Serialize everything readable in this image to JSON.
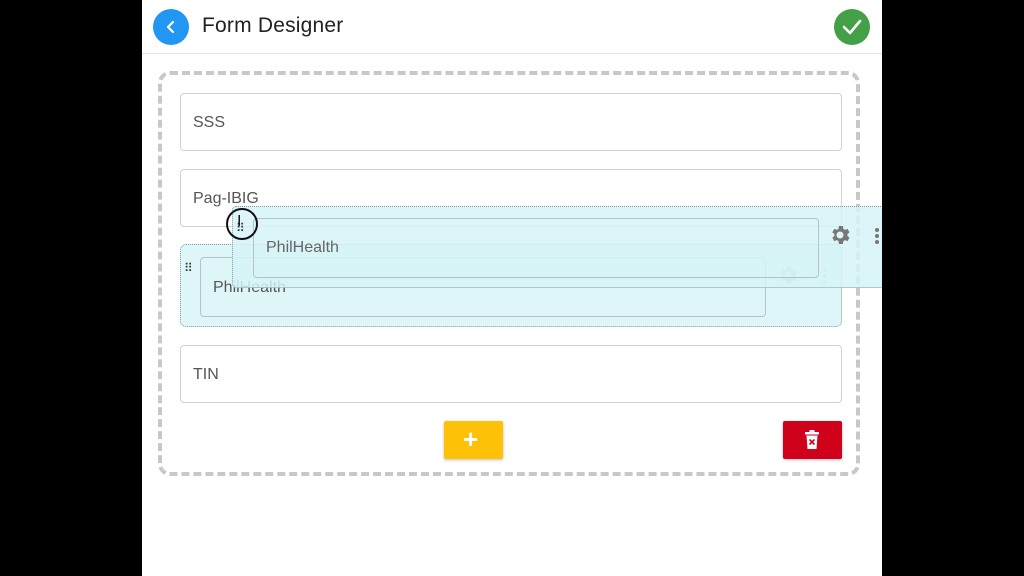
{
  "header": {
    "title": "Form Designer",
    "back_icon": "chevron-left-icon",
    "confirm_icon": "check-icon"
  },
  "fields": [
    {
      "label": "SSS"
    },
    {
      "label": "Pag-IBIG"
    },
    {
      "label": "PhilHealth"
    },
    {
      "label": "TIN"
    }
  ],
  "drag_ghost": {
    "label": "PhilHealth",
    "handle_icon": "drag-handle-icon",
    "settings_icon": "gear-icon",
    "menu_icon": "kebab-menu-icon"
  },
  "actions": {
    "add_label": "+",
    "delete_icon": "trash-icon"
  },
  "colors": {
    "back": "#2196f3",
    "confirm": "#43a047",
    "add": "#ffc107",
    "delete": "#d0021b",
    "highlight": "#dff6f8"
  }
}
